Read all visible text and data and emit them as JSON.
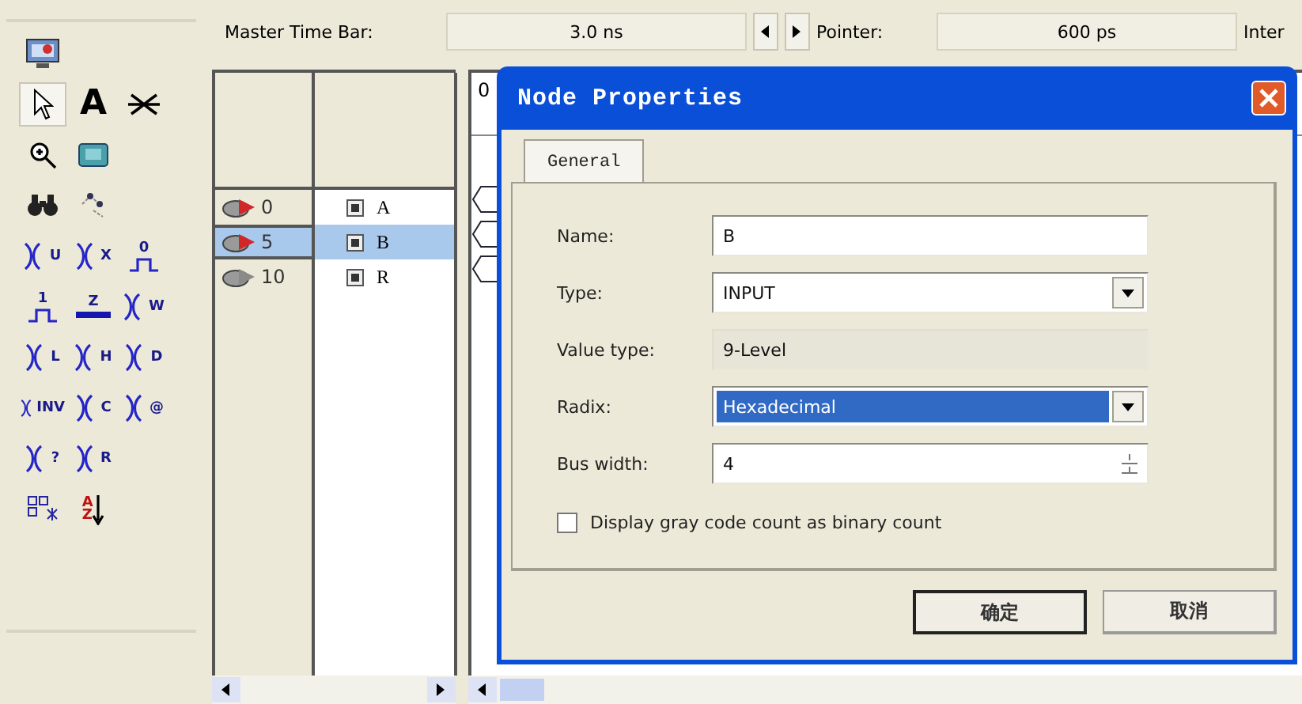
{
  "tools": [
    [
      {
        "kind": "screen",
        "selected": false
      }
    ],
    [
      {
        "kind": "pointer",
        "selected": true
      },
      {
        "kind": "text",
        "glyph": "A",
        "selected": false
      },
      {
        "kind": "node",
        "selected": false
      }
    ],
    [
      {
        "kind": "zoom",
        "selected": false
      },
      {
        "kind": "rect",
        "selected": false
      }
    ],
    [
      {
        "kind": "find",
        "selected": false
      },
      {
        "kind": "snap",
        "selected": false
      }
    ],
    [
      {
        "kind": "wave",
        "glyph": "U",
        "selected": false
      },
      {
        "kind": "invert",
        "glyph": "X",
        "selected": false
      },
      {
        "kind": "level",
        "glyph": "0",
        "selected": false
      }
    ],
    [
      {
        "kind": "level",
        "glyph": "1",
        "selected": false
      },
      {
        "kind": "line",
        "glyph": "Z",
        "selected": false
      },
      {
        "kind": "wave",
        "glyph": "W",
        "selected": false
      }
    ],
    [
      {
        "kind": "wave",
        "glyph": "L",
        "selected": false
      },
      {
        "kind": "wave",
        "glyph": "H",
        "selected": false
      },
      {
        "kind": "wave",
        "glyph": "D",
        "selected": false
      }
    ],
    [
      {
        "kind": "invert",
        "glyph": "INV",
        "selected": false
      },
      {
        "kind": "wave",
        "glyph": "C",
        "selected": false
      },
      {
        "kind": "wave",
        "glyph": "@",
        "selected": false
      }
    ],
    [
      {
        "kind": "wave",
        "glyph": "?",
        "selected": false
      },
      {
        "kind": "wave",
        "glyph": "R",
        "selected": false
      }
    ],
    [
      {
        "kind": "group",
        "selected": false
      },
      {
        "kind": "sort",
        "glyph": "AZ",
        "selected": false
      }
    ]
  ],
  "time_bar": {
    "label": "Master Time Bar:",
    "value": "3.0 ns",
    "pointer_label": "Pointer:",
    "pointer_value": "600 ps",
    "next_label": "Inter"
  },
  "nodes": [
    {
      "value": "0",
      "name": "A",
      "kind": "input",
      "selected": false
    },
    {
      "value": "5",
      "name": "B",
      "kind": "input",
      "selected": true
    },
    {
      "value": "10",
      "name": "R",
      "kind": "output",
      "selected": false
    }
  ],
  "waveform": {
    "ruler_label": "0"
  },
  "dialog": {
    "title": "Node Properties",
    "tabs": [
      {
        "label": "General",
        "selected": true
      }
    ],
    "fields": [
      {
        "kind": "text",
        "label": "Name:",
        "value": "B",
        "focused": false
      },
      {
        "kind": "select",
        "label": "Type:",
        "value": "INPUT",
        "focused": false
      },
      {
        "kind": "readonly",
        "label": "Value type:",
        "value": "9-Level",
        "focused": false
      },
      {
        "kind": "select",
        "label": "Radix:",
        "value": "Hexadecimal",
        "focused": true
      },
      {
        "kind": "spin",
        "label": "Bus width:",
        "value": "4",
        "focused": false
      }
    ],
    "checkbox": {
      "label": "Display gray code count as binary count",
      "checked": false
    },
    "buttons": [
      {
        "label": "确定",
        "default": true
      },
      {
        "label": "取消",
        "default": false
      }
    ]
  }
}
